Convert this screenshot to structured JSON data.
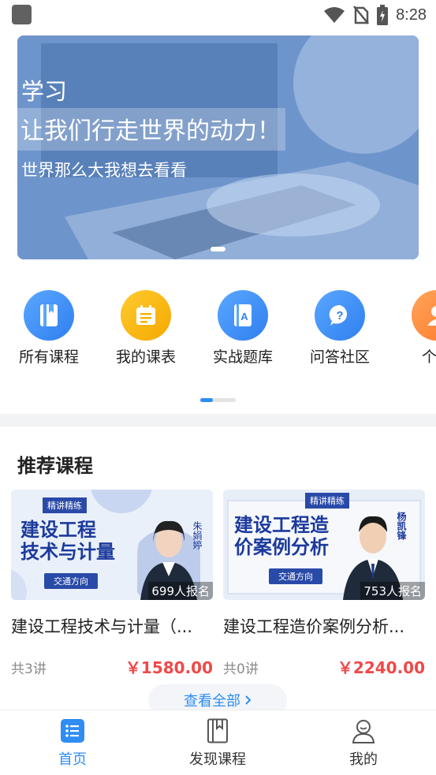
{
  "status_bar": {
    "time": "8:28"
  },
  "banner": {
    "line1": "学习",
    "line2": "让我们行走世界的动力！",
    "line3": "世界那么大我想去看看"
  },
  "quick_nav": [
    {
      "label": "所有课程",
      "icon": "book-icon",
      "color": "#3d8ef5"
    },
    {
      "label": "我的课表",
      "icon": "schedule-icon",
      "color": "#f5b400"
    },
    {
      "label": "实战题库",
      "icon": "question-bank-icon",
      "color": "#3d8ef5"
    },
    {
      "label": "问答社区",
      "icon": "question-bubble-icon",
      "color": "#3d8ef5"
    },
    {
      "label": "个人",
      "icon": "person-icon",
      "color": "#ff8a3d"
    }
  ],
  "section_title": "推荐课程",
  "courses": [
    {
      "thumb_tag": "精讲精练",
      "thumb_title": "建设工程\n技术与计量",
      "thumb_sub": "交通方向",
      "teacher": "朱娟婷",
      "enrolled": "699人报名",
      "title": "建设工程技术与计量（...",
      "lessons": "共3讲",
      "price": "￥1580.00"
    },
    {
      "thumb_tag": "精讲精练",
      "thumb_title": "建设工程造\n价案例分析",
      "thumb_sub": "交通方向",
      "teacher": "杨凯锋",
      "enrolled": "753人报名",
      "title": "建设工程造价案例分析...",
      "lessons": "共0讲",
      "price": "￥2240.00"
    }
  ],
  "view_all": "查看全部",
  "tabs": [
    {
      "label": "首页",
      "icon": "home-list-icon",
      "active": true
    },
    {
      "label": "发现课程",
      "icon": "discover-book-icon",
      "active": false
    },
    {
      "label": "我的",
      "icon": "profile-icon",
      "active": false
    }
  ],
  "colors": {
    "accent": "#2f8df4",
    "price": "#f04848",
    "orange": "#ff8a3d",
    "yellow": "#f5b400"
  }
}
